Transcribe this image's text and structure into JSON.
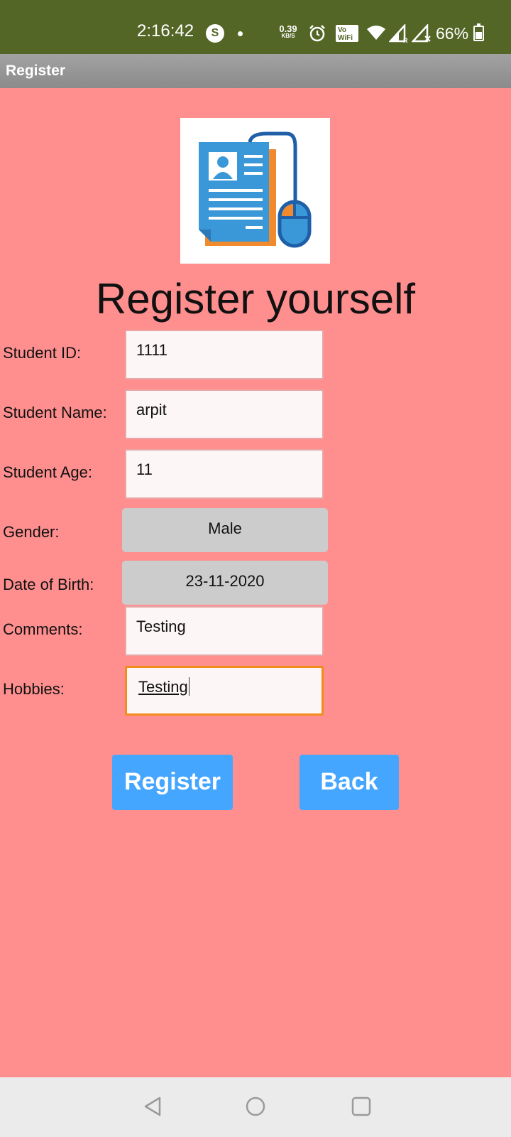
{
  "status_bar": {
    "time": "2:16:42",
    "s_badge": "S",
    "net_speed_value": "0.39",
    "net_speed_unit": "KB/S",
    "battery": "66%",
    "battery_level": 0.66,
    "icons": [
      "alarm-icon",
      "vowifi-icon",
      "wifi-icon",
      "signal-r-icon",
      "signal-x-icon",
      "battery-icon"
    ]
  },
  "app_bar": {
    "title": "Register"
  },
  "main": {
    "heading": "Register yourself",
    "fields": {
      "student_id": {
        "label": "Student ID:",
        "value": "1111"
      },
      "student_name": {
        "label": "Student Name:",
        "value": "arpit"
      },
      "student_age": {
        "label": "Student Age:",
        "value": "11"
      },
      "gender": {
        "label": "Gender:",
        "value": "Male"
      },
      "dob": {
        "label": "Date of Birth:",
        "value": "23-11-2020"
      },
      "comments": {
        "label": "Comments:",
        "value": "Testing"
      },
      "hobbies": {
        "label": "Hobbies:",
        "value": "Testing"
      }
    },
    "buttons": {
      "register": "Register",
      "back": "Back"
    }
  },
  "nav_bar": {
    "icons": [
      "back-nav-icon",
      "home-nav-icon",
      "recents-nav-icon"
    ]
  },
  "colors": {
    "background": "#ff8f8f",
    "status_bar": "#536626",
    "app_bar": "#959595",
    "button": "#45a6ff",
    "picker": "#cccccc",
    "focus_border": "#f28b1a"
  }
}
